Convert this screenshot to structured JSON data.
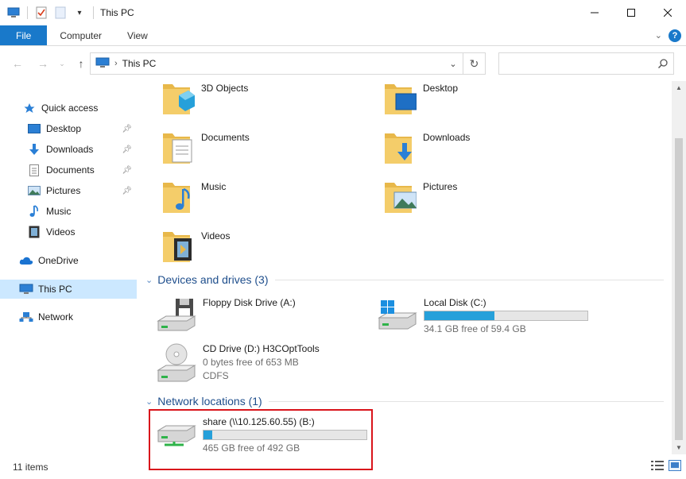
{
  "window": {
    "title": "This PC"
  },
  "ribbon": {
    "tabs": [
      "File",
      "Computer",
      "View"
    ]
  },
  "address": {
    "path": "This PC",
    "search_placeholder": ""
  },
  "sidebar": {
    "items": [
      {
        "label": "Quick access",
        "icon": "star-icon"
      },
      {
        "label": "Desktop",
        "icon": "desktop-icon",
        "pinned": true
      },
      {
        "label": "Downloads",
        "icon": "download-icon",
        "pinned": true
      },
      {
        "label": "Documents",
        "icon": "documents-icon",
        "pinned": true
      },
      {
        "label": "Pictures",
        "icon": "pictures-icon",
        "pinned": true
      },
      {
        "label": "Music",
        "icon": "music-icon"
      },
      {
        "label": "Videos",
        "icon": "videos-icon"
      },
      {
        "label": "OneDrive",
        "icon": "cloud-icon"
      },
      {
        "label": "This PC",
        "icon": "computer-icon",
        "selected": true
      },
      {
        "label": "Network",
        "icon": "network-icon"
      }
    ]
  },
  "folders": [
    {
      "label": "3D Objects"
    },
    {
      "label": "Desktop"
    },
    {
      "label": "Documents"
    },
    {
      "label": "Downloads"
    },
    {
      "label": "Music"
    },
    {
      "label": "Pictures"
    },
    {
      "label": "Videos"
    }
  ],
  "groups": {
    "devices": "Devices and drives (3)",
    "network": "Network locations (1)"
  },
  "drives": {
    "floppy": {
      "name": "Floppy Disk Drive (A:)"
    },
    "local": {
      "name": "Local Disk (C:)",
      "free": "34.1 GB free of 59.4 GB",
      "used_fraction": 0.43
    },
    "cd": {
      "name": "CD Drive (D:) H3COptTools",
      "free": "0 bytes free of 653 MB",
      "fs": "CDFS"
    },
    "share": {
      "name": "share (\\\\10.125.60.55) (B:)",
      "free": "465 GB free of 492 GB",
      "used_fraction": 0.055
    }
  },
  "status": {
    "items": "11 items"
  },
  "colors": {
    "accent": "#1979ca",
    "bar_fill": "#26a0da",
    "highlight": "#d9141b",
    "group_title": "#1e4e8c"
  }
}
